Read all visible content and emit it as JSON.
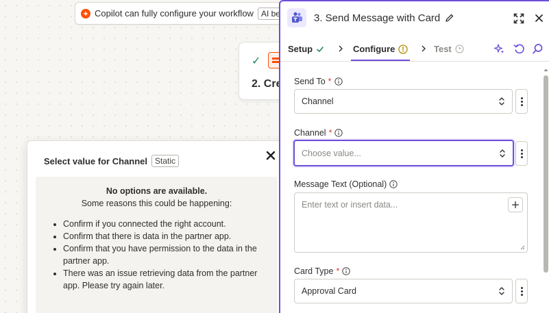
{
  "copilot": {
    "text": "Copilot can fully configure your workflow",
    "badge": "AI be"
  },
  "step_card": {
    "number_title": "2. Cre"
  },
  "value_popup": {
    "title": "Select value for Channel",
    "badge": "Static",
    "empty_title": "No options are available.",
    "empty_subtitle": "Some reasons this could be happening:",
    "reasons": [
      "Confirm if you connected the right account.",
      "Confirm that there is data in the partner app.",
      "Confirm that you have permission to the data in the partner app.",
      "There was an issue retrieving data from the partner app. Please try again later."
    ]
  },
  "panel": {
    "title": "3. Send Message with Card",
    "tabs": {
      "setup": "Setup",
      "configure": "Configure",
      "test": "Test"
    },
    "fields": {
      "send_to": {
        "label": "Send To",
        "value": "Channel"
      },
      "channel": {
        "label": "Channel",
        "placeholder": "Choose value..."
      },
      "message_text": {
        "label": "Message Text (Optional)",
        "placeholder": "Enter text or insert data..."
      },
      "card_type": {
        "label": "Card Type",
        "value": "Approval Card"
      }
    },
    "required_mark": "*"
  },
  "colors": {
    "accent": "#6d4ed8",
    "brand_orange": "#ff4f00",
    "success": "#1d8a4f",
    "required": "#d93a2b",
    "warning": "#b58a00"
  }
}
